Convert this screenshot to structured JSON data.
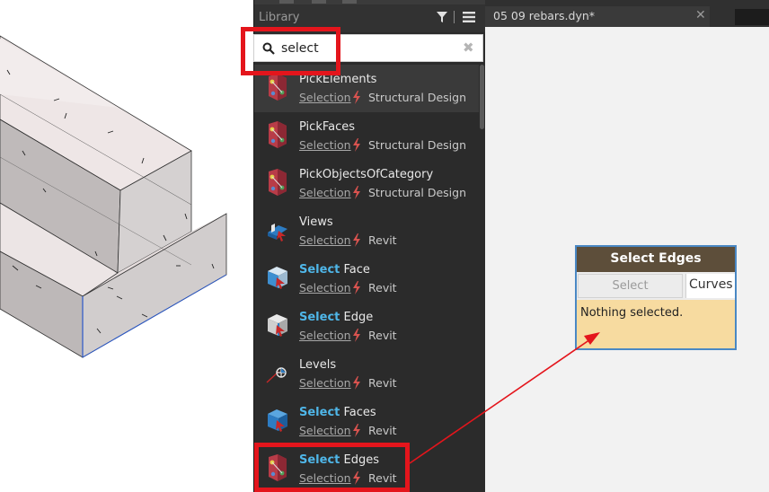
{
  "library": {
    "title": "Library",
    "filter_icon": "filter-icon",
    "layout_icon": "list-layout-icon",
    "search": {
      "value": "select",
      "placeholder": "",
      "clear_glyph": "✖"
    },
    "results": [
      {
        "name": "PickElements",
        "highlight": "",
        "rest": "PickElements",
        "category": "Selection",
        "library": "Structural Design",
        "icon": "structural-node-icon"
      },
      {
        "name": "PickFaces",
        "highlight": "",
        "rest": "PickFaces",
        "category": "Selection",
        "library": "Structural Design",
        "icon": "structural-node-icon"
      },
      {
        "name": "PickObjectsOfCategory",
        "highlight": "",
        "rest": "PickObjectsOfCategory",
        "category": "Selection",
        "library": "Structural Design",
        "icon": "structural-node-icon"
      },
      {
        "name": "Views",
        "highlight": "",
        "rest": "Views",
        "category": "Selection",
        "library": "Revit",
        "icon": "views-icon"
      },
      {
        "name": "Select Face",
        "highlight": "Select",
        "rest": " Face",
        "category": "Selection",
        "library": "Revit",
        "icon": "select-face-icon"
      },
      {
        "name": "Select Edge",
        "highlight": "Select",
        "rest": " Edge",
        "category": "Selection",
        "library": "Revit",
        "icon": "select-edge-icon"
      },
      {
        "name": "Levels",
        "highlight": "",
        "rest": "Levels",
        "category": "Selection",
        "library": "Revit",
        "icon": "levels-icon"
      },
      {
        "name": "Select Faces",
        "highlight": "Select",
        "rest": " Faces",
        "category": "Selection",
        "library": "Revit",
        "icon": "select-faces-icon"
      },
      {
        "name": "Select Edges",
        "highlight": "Select",
        "rest": " Edges",
        "category": "Selection",
        "library": "Revit",
        "icon": "select-edges-icon"
      }
    ]
  },
  "canvas": {
    "tab_label": "05 09 rebars.dyn*",
    "tab_close": "✕"
  },
  "node": {
    "title": "Select Edges",
    "button_label": "Select",
    "output_port": "Curves",
    "status": "Nothing selected."
  },
  "colors": {
    "highlight_red": "#e4151c",
    "search_highlight": "#4fb6e8",
    "node_header": "#5d4e3a",
    "node_body": "#f7dba0",
    "node_border": "#4a88c4",
    "panel_bg": "#2b2b2b"
  }
}
